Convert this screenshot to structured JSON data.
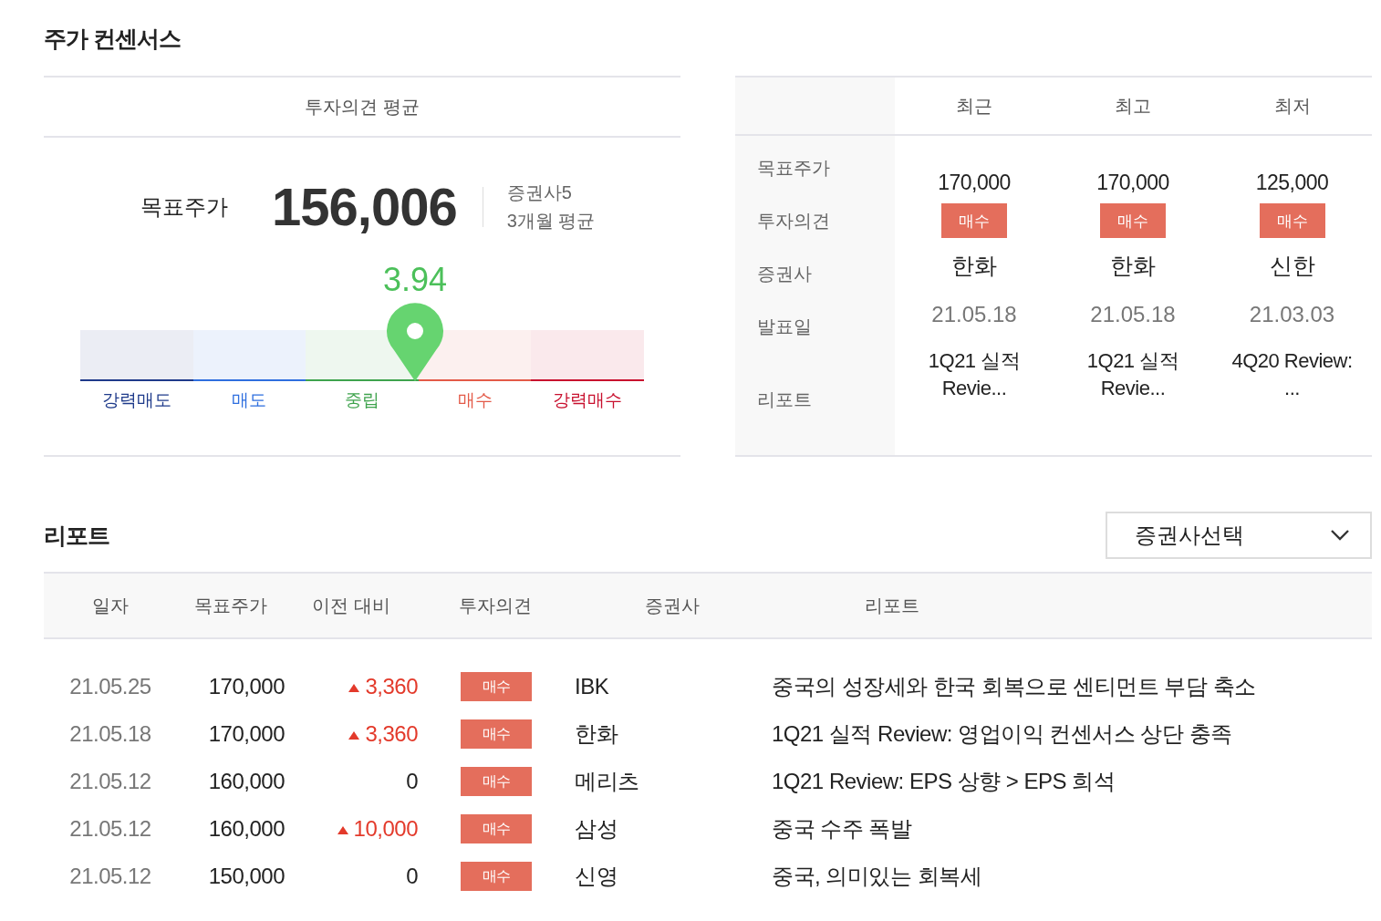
{
  "consensus": {
    "title": "주가 컨센서스",
    "summary": {
      "header": "투자의견 평균",
      "target_label": "목표주가",
      "target_value": "156,006",
      "brokers": "증권사5",
      "period": "3개월 평균",
      "score": "3.94",
      "level": 0.594,
      "scale": [
        {
          "label": "강력매도",
          "color": "#1e3a8a"
        },
        {
          "label": "매도",
          "color": "#2f6fdf"
        },
        {
          "label": "중립",
          "color": "#3fa34d"
        },
        {
          "label": "매수",
          "color": "#e35a48"
        },
        {
          "label": "강력매수",
          "color": "#c8102e"
        }
      ]
    },
    "compare": {
      "columns": [
        "최근",
        "최고",
        "최저"
      ],
      "row_labels": [
        "목표주가",
        "투자의견",
        "증권사",
        "발표일",
        "리포트"
      ],
      "items": [
        {
          "price": "170,000",
          "opinion": "매수",
          "broker": "한화",
          "date": "21.05.18",
          "report": [
            "1Q21 실적",
            "Revie..."
          ]
        },
        {
          "price": "170,000",
          "opinion": "매수",
          "broker": "한화",
          "date": "21.05.18",
          "report": [
            "1Q21 실적",
            "Revie..."
          ]
        },
        {
          "price": "125,000",
          "opinion": "매수",
          "broker": "신한",
          "date": "21.03.03",
          "report": [
            "4Q20 Review:",
            "..."
          ]
        }
      ]
    }
  },
  "reports": {
    "title": "리포트",
    "select": "증권사선택",
    "columns": [
      "일자",
      "목표주가",
      "이전 대비",
      "투자의견",
      "증권사",
      "리포트"
    ],
    "rows": [
      {
        "date": "21.05.25",
        "price": "170,000",
        "change": "3,360",
        "up": true,
        "opinion": "매수",
        "broker": "IBK",
        "report": "중국의 성장세와 한국 회복으로 센티먼트 부담 축소"
      },
      {
        "date": "21.05.18",
        "price": "170,000",
        "change": "3,360",
        "up": true,
        "opinion": "매수",
        "broker": "한화",
        "report": "1Q21 실적 Review: 영업이익 컨센서스 상단 충족"
      },
      {
        "date": "21.05.12",
        "price": "160,000",
        "change": "0",
        "up": false,
        "opinion": "매수",
        "broker": "메리츠",
        "report": "1Q21 Review: EPS 상향 > EPS 희석"
      },
      {
        "date": "21.05.12",
        "price": "160,000",
        "change": "10,000",
        "up": true,
        "opinion": "매수",
        "broker": "삼성",
        "report": "중국 수주 폭발"
      },
      {
        "date": "21.05.12",
        "price": "150,000",
        "change": "0",
        "up": false,
        "opinion": "매수",
        "broker": "신영",
        "report": "중국, 의미있는 회복세"
      }
    ]
  }
}
